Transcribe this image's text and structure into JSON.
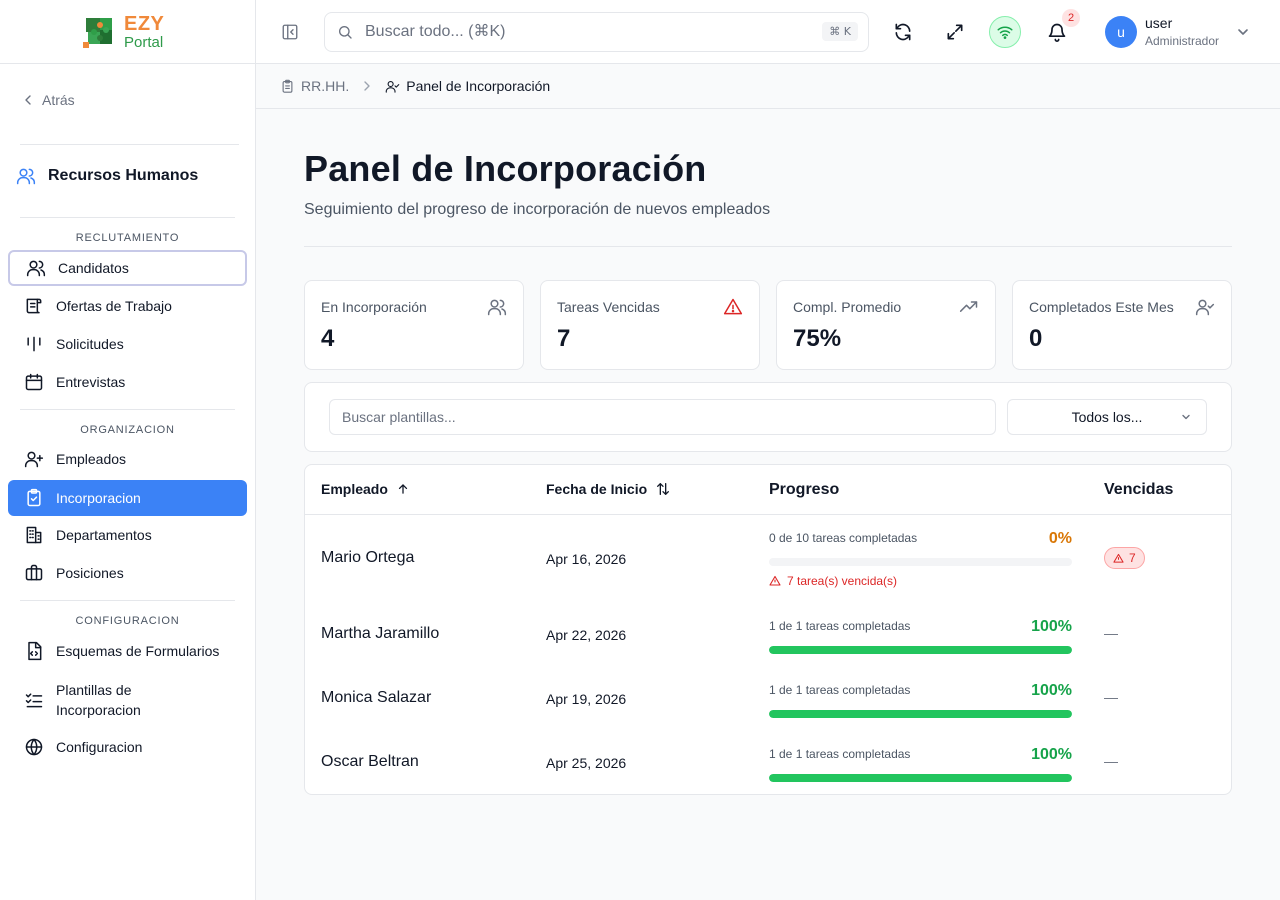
{
  "app": {
    "logo_line1": "EZY",
    "logo_line2": "Portal"
  },
  "sidebar": {
    "back_label": "Atrás",
    "module_title": "Recursos Humanos",
    "sections": [
      {
        "label": "RECLUTAMIENTO",
        "items": [
          {
            "label": "Candidatos",
            "icon": "users-icon"
          },
          {
            "label": "Ofertas de Trabajo",
            "icon": "scroll-icon"
          },
          {
            "label": "Solicitudes",
            "icon": "bars-icon"
          },
          {
            "label": "Entrevistas",
            "icon": "calendar-icon"
          }
        ]
      },
      {
        "label": "ORGANIZACION",
        "items": [
          {
            "label": "Empleados",
            "icon": "user-plus-icon"
          },
          {
            "label": "Incorporacion",
            "icon": "clipboard-check-icon"
          },
          {
            "label": "Departamentos",
            "icon": "building-icon"
          },
          {
            "label": "Posiciones",
            "icon": "briefcase-icon"
          }
        ]
      },
      {
        "label": "CONFIGURACION",
        "items": [
          {
            "label": "Esquemas de Formularios",
            "icon": "file-code-icon"
          },
          {
            "label_line1": "Plantillas de",
            "label_line2": "Incorporacion",
            "icon": "list-check-icon"
          },
          {
            "label": "Configuracion",
            "icon": "globe-icon"
          }
        ]
      }
    ]
  },
  "topbar": {
    "search_placeholder": "Buscar todo... (⌘K)",
    "shortcut": "⌘ K",
    "notifications_count": "2",
    "user": {
      "initial": "u",
      "name": "user",
      "role": "Administrador"
    }
  },
  "breadcrumb": {
    "parent": "RR.HH.",
    "current": "Panel de Incorporación"
  },
  "page": {
    "title": "Panel de Incorporación",
    "subtitle": "Seguimiento del progreso de incorporación de nuevos empleados"
  },
  "stats": [
    {
      "label": "En Incorporación",
      "value": "4",
      "icon": "users-icon"
    },
    {
      "label": "Tareas Vencidas",
      "value": "7",
      "icon": "alert-triangle-icon"
    },
    {
      "label": "Compl. Promedio",
      "value": "75%",
      "icon": "trending-up-icon"
    },
    {
      "label": "Completados Este Mes",
      "value": "0",
      "icon": "user-check-icon"
    }
  ],
  "filters": {
    "search_placeholder": "Buscar plantillas...",
    "select_value": "Todos los..."
  },
  "table": {
    "headers": {
      "employee": "Empleado",
      "start_date": "Fecha de Inicio",
      "progress": "Progreso",
      "overdue": "Vencidas"
    },
    "rows": [
      {
        "name": "Mario Ortega",
        "date": "Apr 16, 2026",
        "progress_text": "0 de 10 tareas completadas",
        "percent_label": "0%",
        "percent": 0,
        "overdue_note": "7 tarea(s) vencida(s)",
        "overdue": "7"
      },
      {
        "name": "Martha Jaramillo",
        "date": "Apr 22, 2026",
        "progress_text": "1 de 1 tareas completadas",
        "percent_label": "100%",
        "percent": 100,
        "overdue": "—"
      },
      {
        "name": "Monica Salazar",
        "date": "Apr 19, 2026",
        "progress_text": "1 de 1 tareas completadas",
        "percent_label": "100%",
        "percent": 100,
        "overdue": "—"
      },
      {
        "name": "Oscar Beltran",
        "date": "Apr 25, 2026",
        "progress_text": "1 de 1 tareas completadas",
        "percent_label": "100%",
        "percent": 100,
        "overdue": "—"
      }
    ]
  },
  "colors": {
    "accent": "#3b82f6",
    "success": "#22c55e",
    "success_text": "#16a34a",
    "warning_text": "#d97706",
    "danger": "#dc2626"
  }
}
